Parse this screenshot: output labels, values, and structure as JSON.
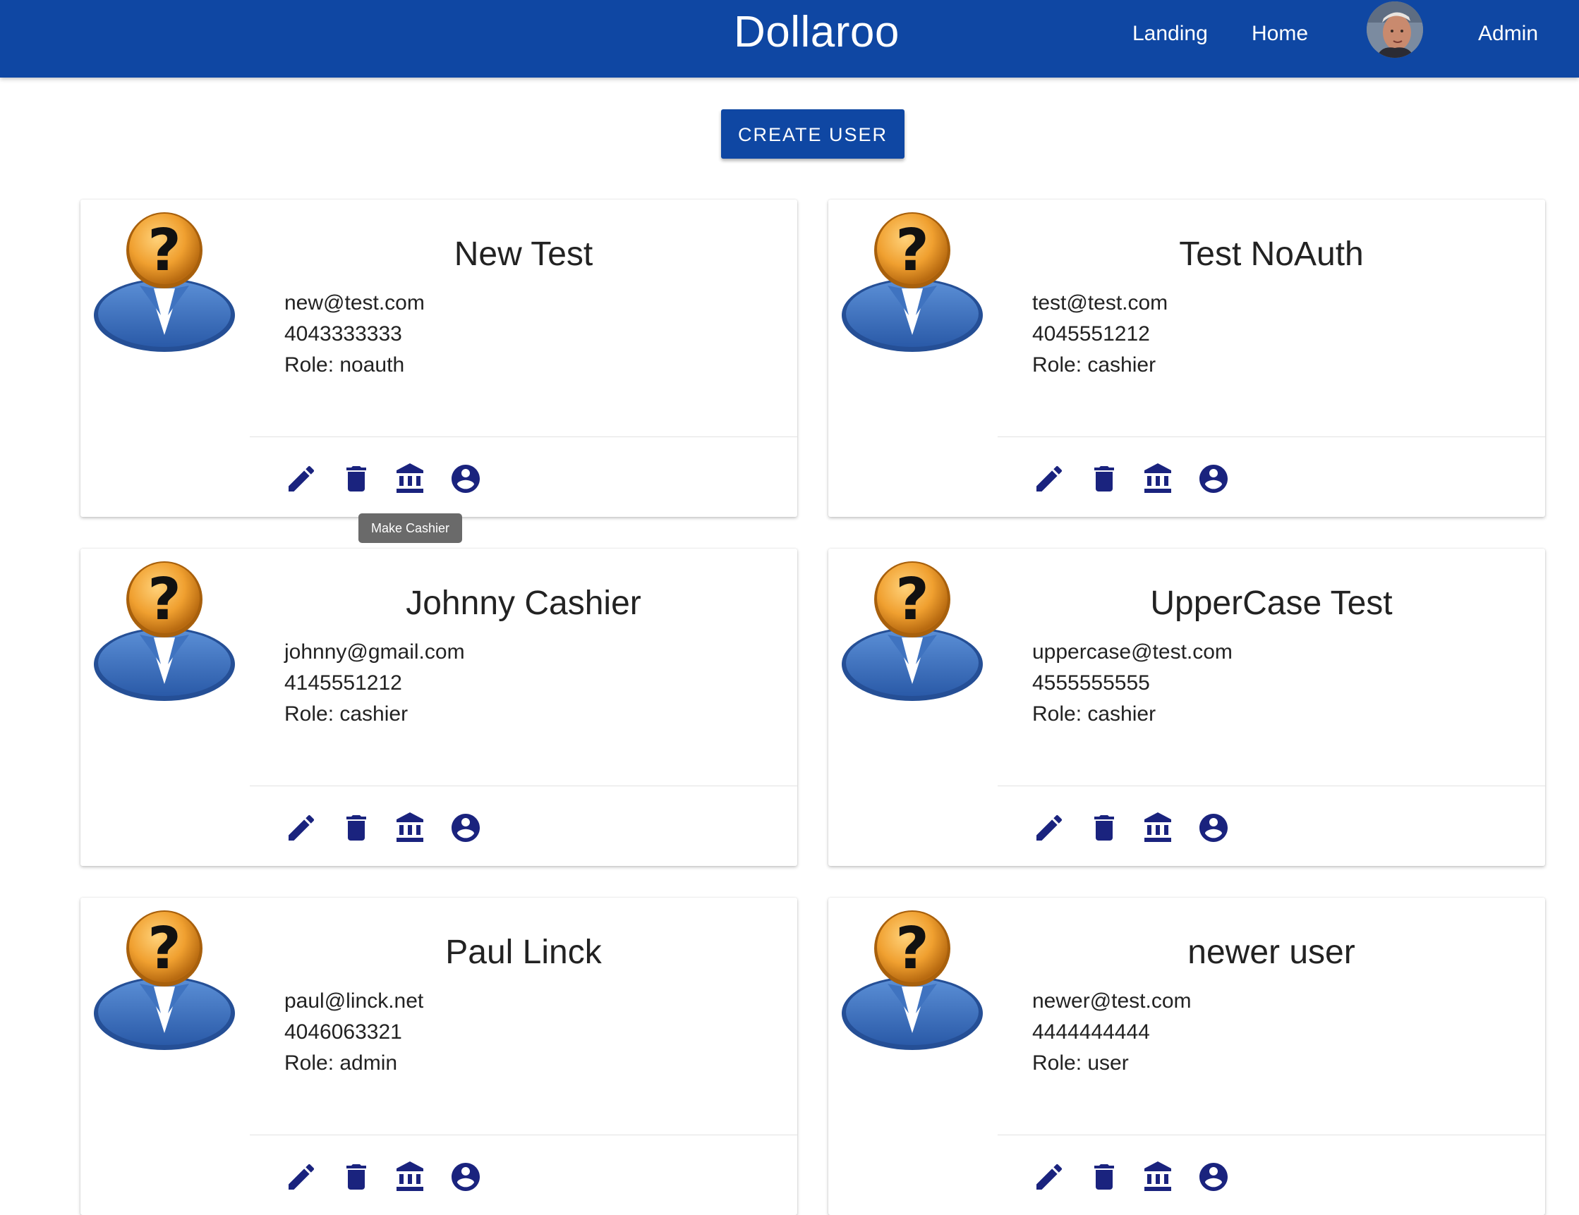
{
  "header": {
    "title": "Dollaroo",
    "nav": {
      "landing": "Landing",
      "home": "Home",
      "admin": "Admin"
    },
    "color": "#0f47a3"
  },
  "toolbar": {
    "create_user_label": "CREATE USER"
  },
  "tooltip": {
    "text": "Make Cashier"
  },
  "icon_color": "#1a237e",
  "users": [
    {
      "name": "New Test",
      "email": "new@test.com",
      "phone": "4043333333",
      "role": "Role: noauth"
    },
    {
      "name": "Test NoAuth",
      "email": "test@test.com",
      "phone": "4045551212",
      "role": "Role: cashier"
    },
    {
      "name": "Johnny Cashier",
      "email": "johnny@gmail.com",
      "phone": "4145551212",
      "role": "Role: cashier"
    },
    {
      "name": "UpperCase Test",
      "email": "uppercase@test.com",
      "phone": "4555555555",
      "role": "Role: cashier"
    },
    {
      "name": "Paul Linck",
      "email": "paul@linck.net",
      "phone": "4046063321",
      "role": "Role: admin"
    },
    {
      "name": "newer user",
      "email": "newer@test.com",
      "phone": "4444444444",
      "role": "Role: user"
    }
  ]
}
